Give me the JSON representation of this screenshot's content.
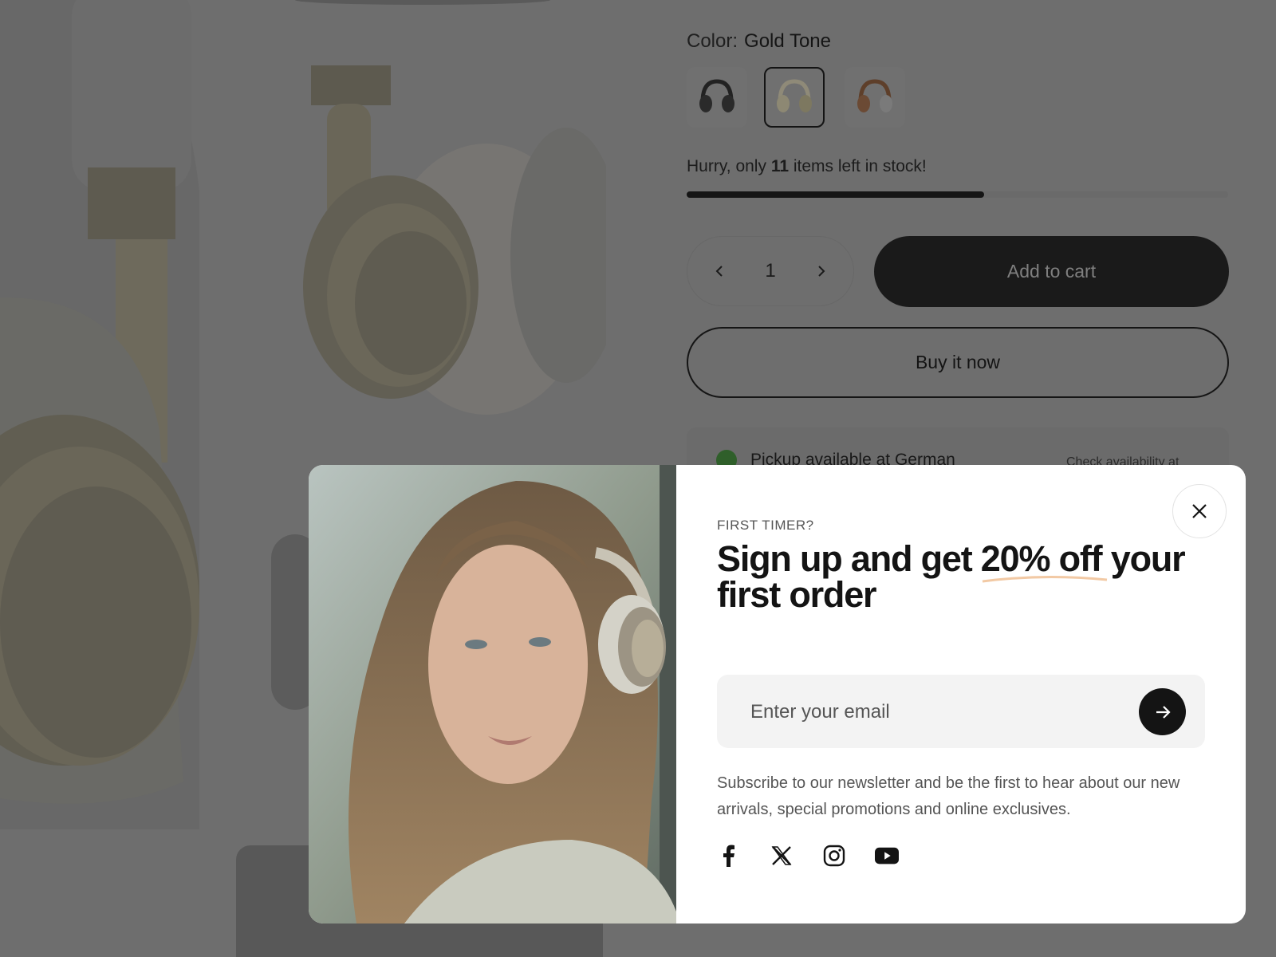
{
  "product": {
    "color_label": "Color:",
    "color_value": "Gold Tone",
    "swatches": [
      {
        "name": "Black",
        "color": "#2a2a2a",
        "selected": false
      },
      {
        "name": "Gold Tone",
        "color": "#b8ad8f",
        "selected": true
      },
      {
        "name": "Brown",
        "color": "#8a5a3a",
        "selected": false
      }
    ],
    "stock_prefix": "Hurry, only",
    "stock_count": "11",
    "stock_suffix": "items left in stock!",
    "stock_level": 0.55,
    "quantity": "1",
    "add_to_cart": "Add to cart",
    "buy_now": "Buy it now",
    "pickup_text": "Pickup available at German",
    "pickup_link": "Check availability at"
  },
  "modal": {
    "eyebrow": "FIRST TIMER?",
    "headline_part1": "Sign up and get",
    "headline_highlight": "20% off",
    "headline_part2": "your first order",
    "email_placeholder": "Enter your email",
    "description": "Subscribe to our newsletter and be the first to hear about our new arrivals, special promotions and online exclusives.",
    "social_icons": [
      "facebook-icon",
      "x-icon",
      "instagram-icon",
      "youtube-icon"
    ]
  },
  "colors": {
    "overlay_bg": "#6e6e6e",
    "accent_dark": "#141414",
    "highlight_underline": "#f2c9a4"
  }
}
